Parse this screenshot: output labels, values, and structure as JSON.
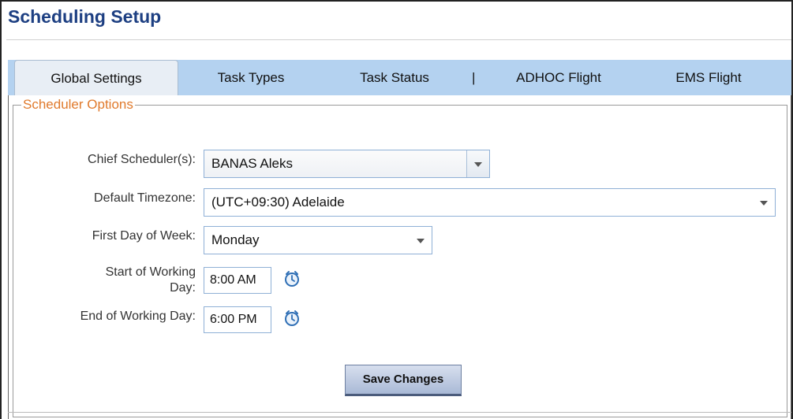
{
  "page": {
    "title": "Scheduling Setup"
  },
  "tabs": [
    {
      "label": "Global Settings",
      "active": true
    },
    {
      "label": "Task Types",
      "active": false
    },
    {
      "label": "Task Status",
      "active": false
    },
    {
      "label": "ADHOC Flight",
      "active": false
    },
    {
      "label": "EMS Flight",
      "active": false
    }
  ],
  "tab_separator": "|",
  "section": {
    "legend": "Scheduler Options"
  },
  "form": {
    "chief_scheduler": {
      "label": "Chief Scheduler(s):",
      "value": "BANAS Aleks"
    },
    "default_timezone": {
      "label": "Default Timezone:",
      "value": "(UTC+09:30) Adelaide"
    },
    "first_day": {
      "label": "First Day of Week:",
      "value": "Monday"
    },
    "start_day": {
      "label_line1": "Start of Working",
      "label_line2": "Day:",
      "value": "8:00 AM"
    },
    "end_day": {
      "label": "End of Working Day:",
      "value": "6:00 PM"
    }
  },
  "buttons": {
    "save_label": "Save Changes"
  },
  "icons": {
    "dropdown": "chevron-down-icon",
    "clock": "clock-icon"
  },
  "colors": {
    "title": "#1d3f82",
    "legend": "#e07a2c",
    "tabbar": "#b4d2f0"
  }
}
